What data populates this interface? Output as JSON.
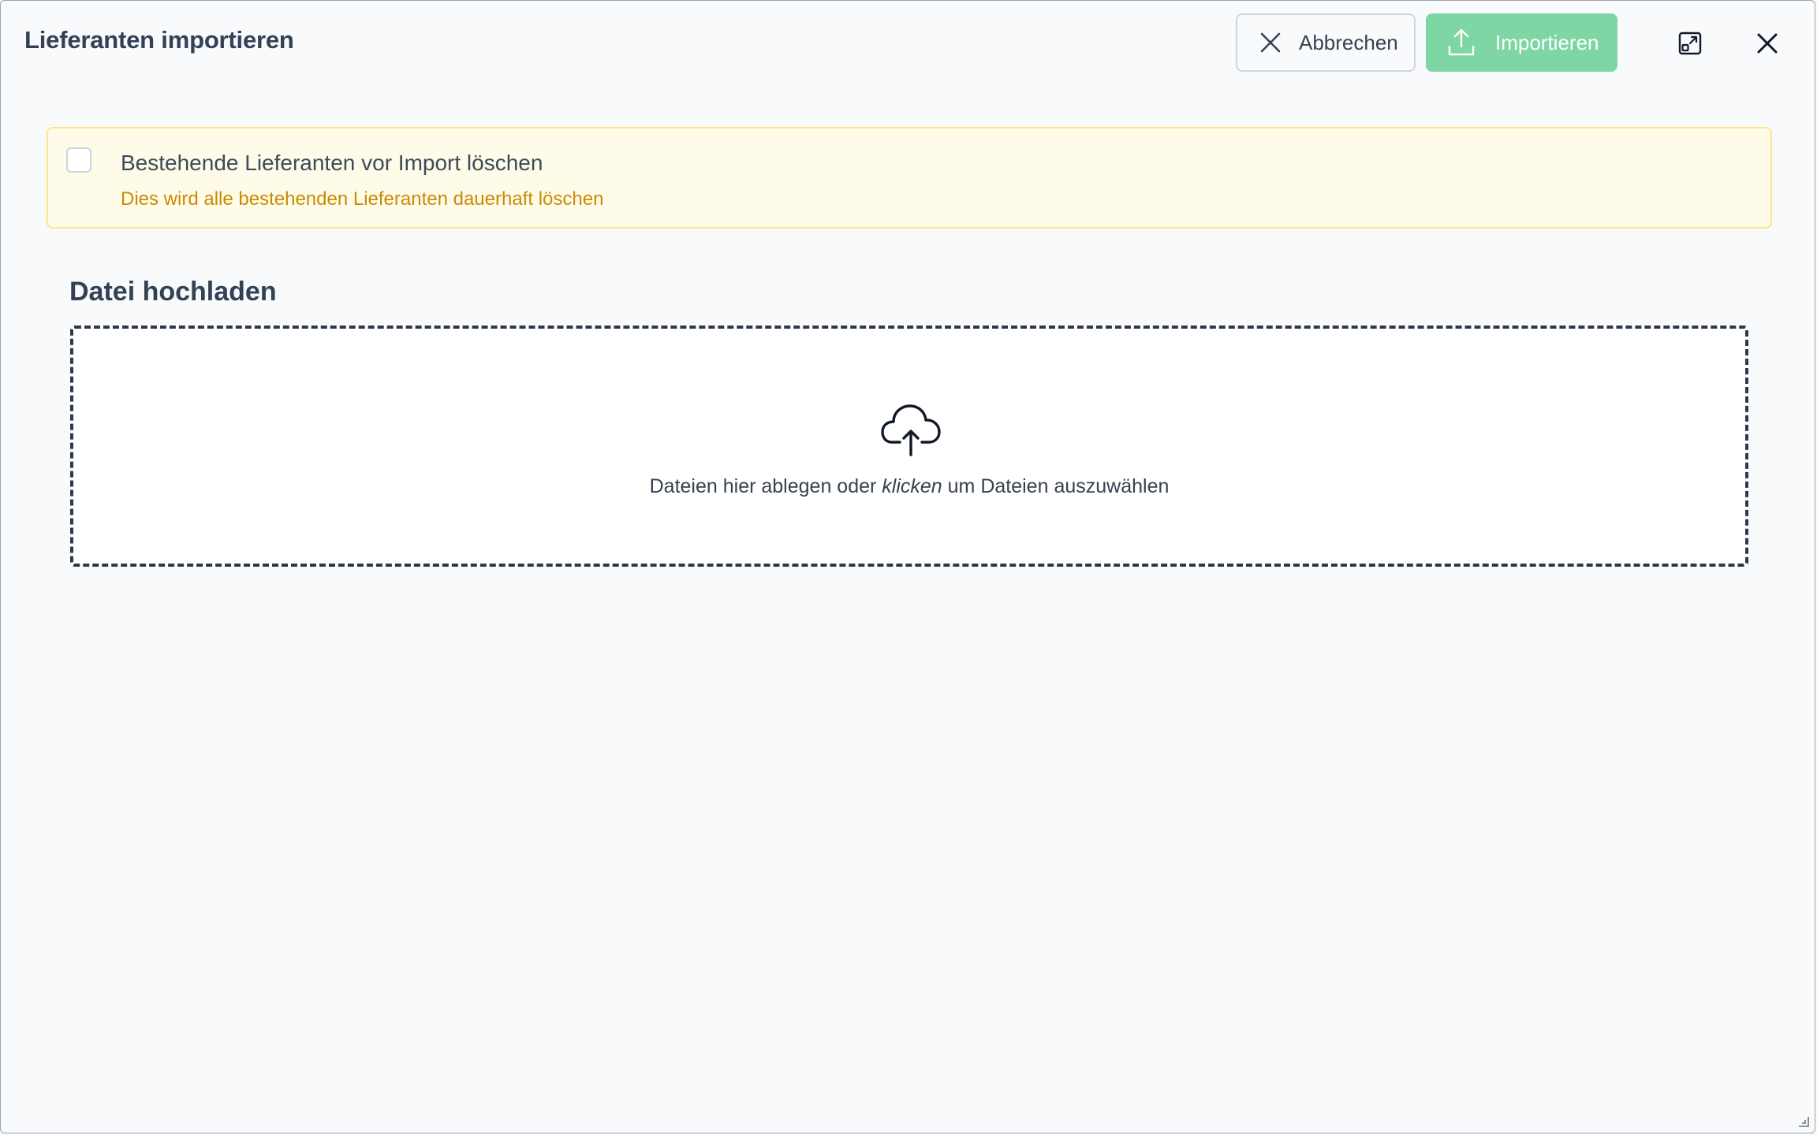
{
  "dialog": {
    "title": "Lieferanten importieren"
  },
  "toolbar": {
    "cancel_label": "Abbrechen",
    "import_label": "Importieren",
    "import_color": "#7ed6a4",
    "icons": [
      "close-icon",
      "upload-icon",
      "maximize-icon",
      "close-icon"
    ]
  },
  "warning": {
    "checkbox_checked": false,
    "title": "Bestehende Lieferanten vor Import löschen",
    "description": "Dies wird alle bestehenden Lieferanten dauerhaft löschen",
    "background": "#fefce8",
    "accent": "#ca8a04"
  },
  "upload": {
    "section_title": "Datei hochladen",
    "text_before": "Dateien hier ablegen oder ",
    "text_emphasis": "klicken",
    "text_after": " um Dateien auszuwählen",
    "icon": "cloud-upload-icon"
  }
}
